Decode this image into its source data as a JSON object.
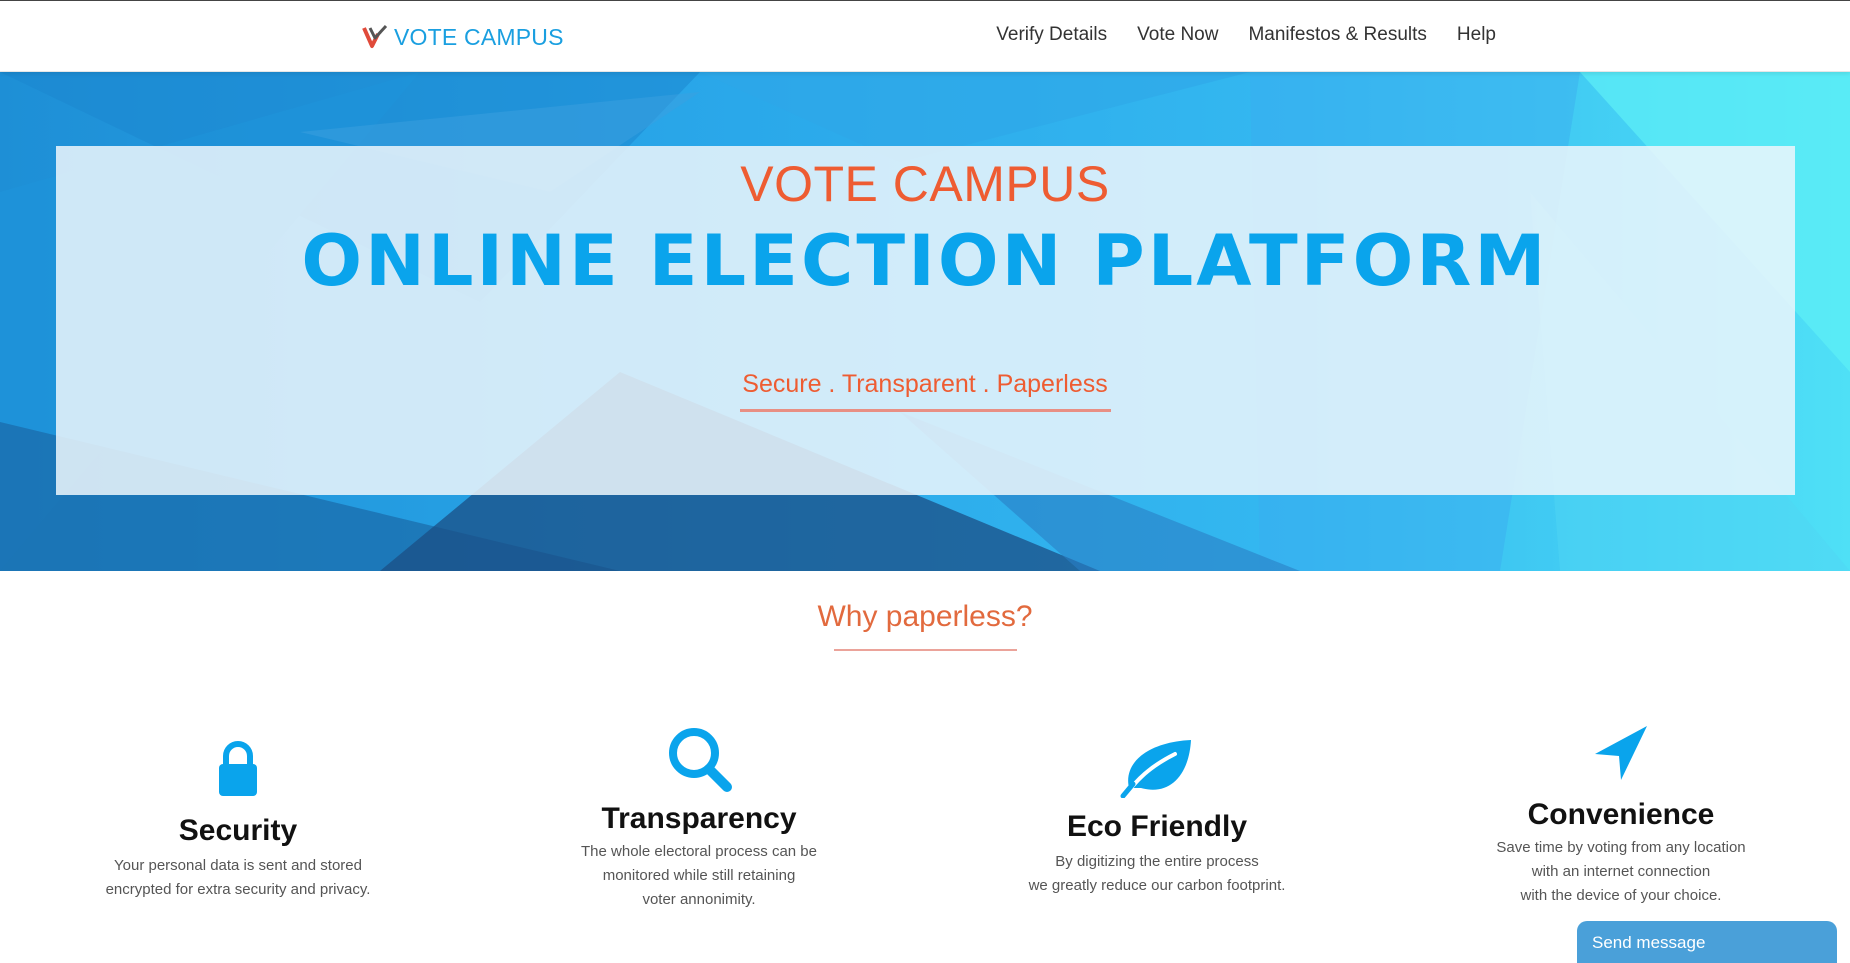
{
  "brand": {
    "name": "VOTE CAMPUS",
    "logo_icon": "vote-check-logo-icon"
  },
  "nav": {
    "items": [
      {
        "label": "Verify Details"
      },
      {
        "label": "Vote Now"
      },
      {
        "label": "Manifestos & Results"
      },
      {
        "label": "Help"
      }
    ]
  },
  "hero": {
    "kicker": "VOTE CAMPUS",
    "title": "ONLINE ELECTION PLATFORM",
    "tagline": "Secure . Transparent . Paperless"
  },
  "why": {
    "title": "Why paperless?",
    "features": [
      {
        "icon": "lock-icon",
        "title": "Security",
        "lines": [
          "Your personal data is sent and stored",
          "encrypted for extra security and privacy."
        ]
      },
      {
        "icon": "search-icon",
        "title": "Transparency",
        "lines": [
          "The whole electoral process can be",
          "monitored while still retaining",
          "voter annonimity."
        ]
      },
      {
        "icon": "leaf-icon",
        "title": "Eco Friendly",
        "lines": [
          "By digitizing the entire process",
          "we greatly reduce our carbon footprint."
        ]
      },
      {
        "icon": "location-arrow-icon",
        "title": "Convenience",
        "lines": [
          "Save time by voting from any location",
          "with an internet connection",
          "with the device of your choice."
        ]
      }
    ]
  },
  "chat": {
    "label": "Send message"
  },
  "colors": {
    "accent": "#0aa4ec",
    "orange": "#ee5c32",
    "chat": "#4aa0d9"
  }
}
